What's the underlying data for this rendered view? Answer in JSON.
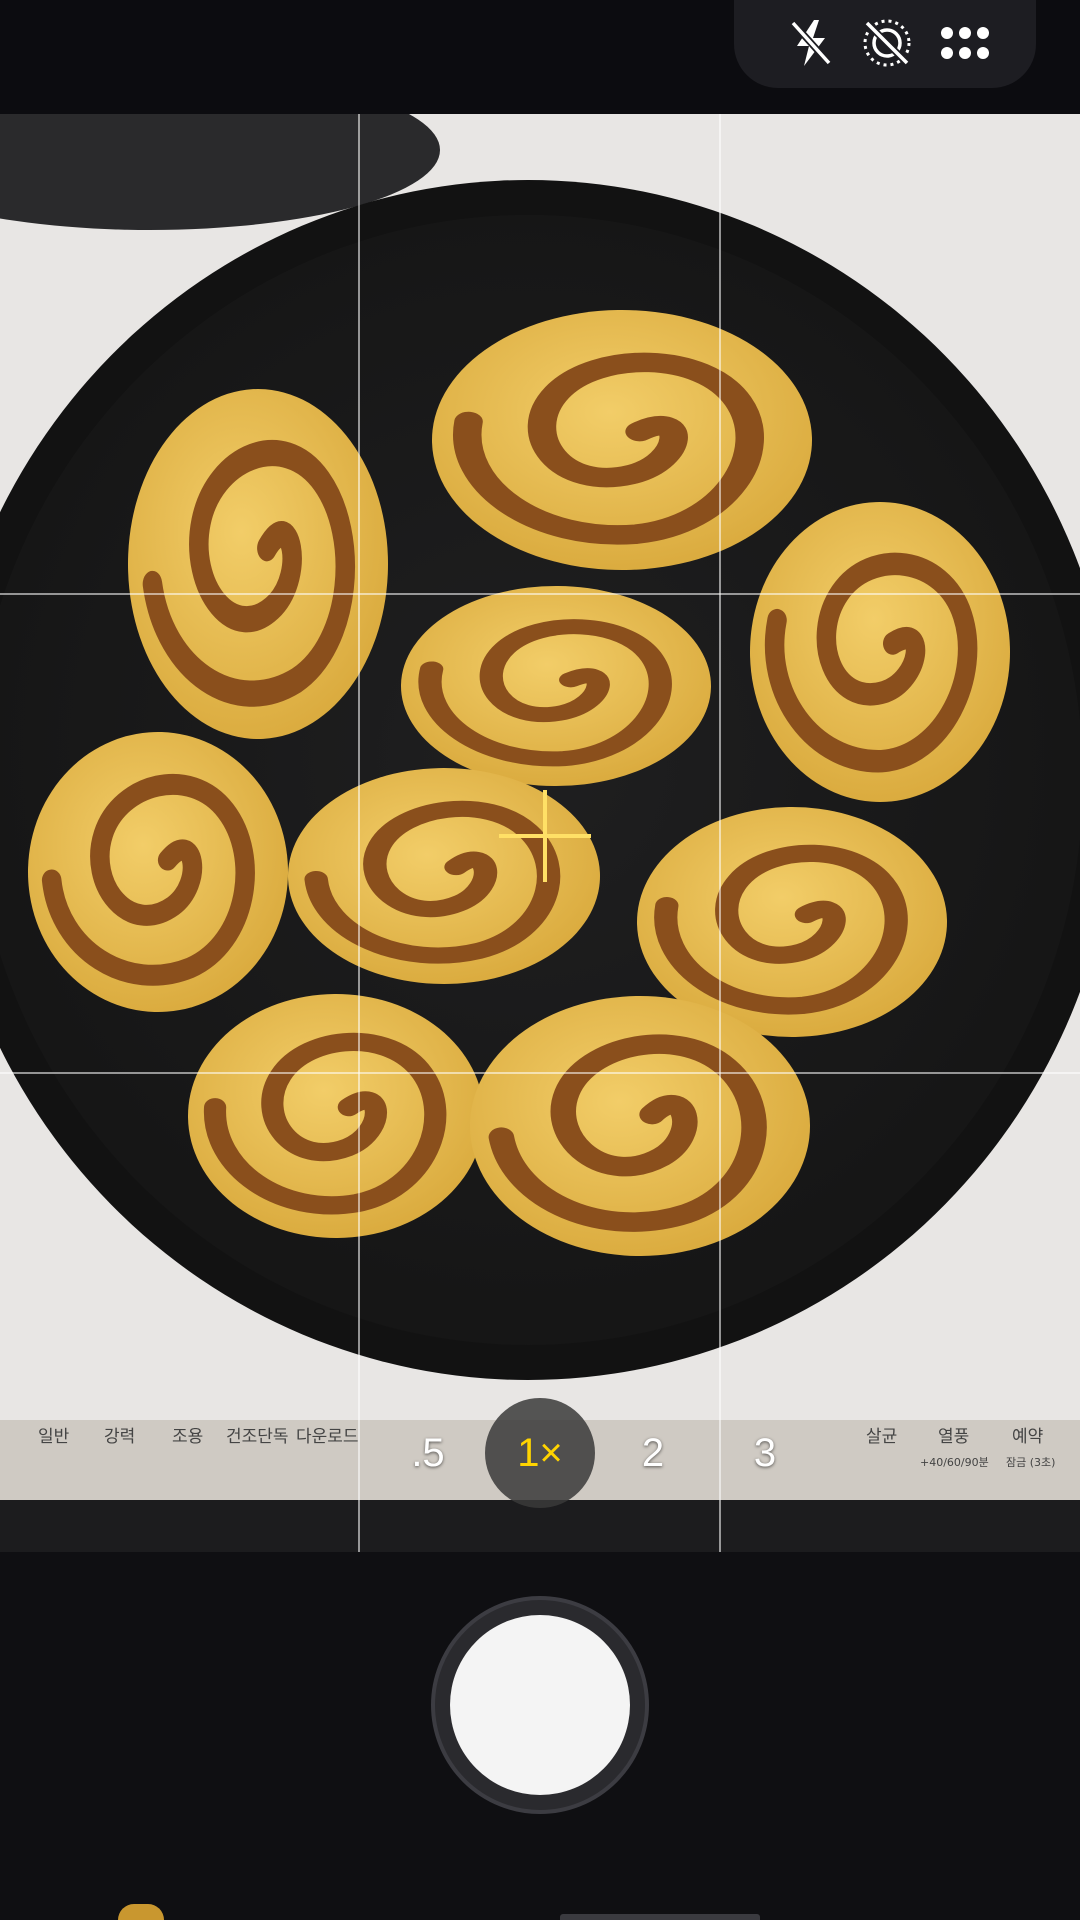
{
  "top_bar": {
    "buttons": [
      {
        "icon": "flash-off-icon"
      },
      {
        "icon": "motion-photo-off-icon"
      },
      {
        "icon": "more-options-icon"
      }
    ]
  },
  "viewfinder": {
    "subject": "cinnamon rolls in round pan",
    "label_strip_text": [
      "일반",
      "강력",
      "조용",
      "건조단독",
      "다운로드",
      "살균",
      "열풍",
      "예약",
      "+40/60/90분",
      "잠금 (3초)"
    ]
  },
  "zoom": {
    "options": [
      ".5",
      "1×",
      "2",
      "3"
    ],
    "active_index": 1,
    "active_color": "#ffd400"
  },
  "colors": {
    "background": "#0f0f12",
    "accent": "#ffd400",
    "shutter": "#f4f4f4"
  }
}
